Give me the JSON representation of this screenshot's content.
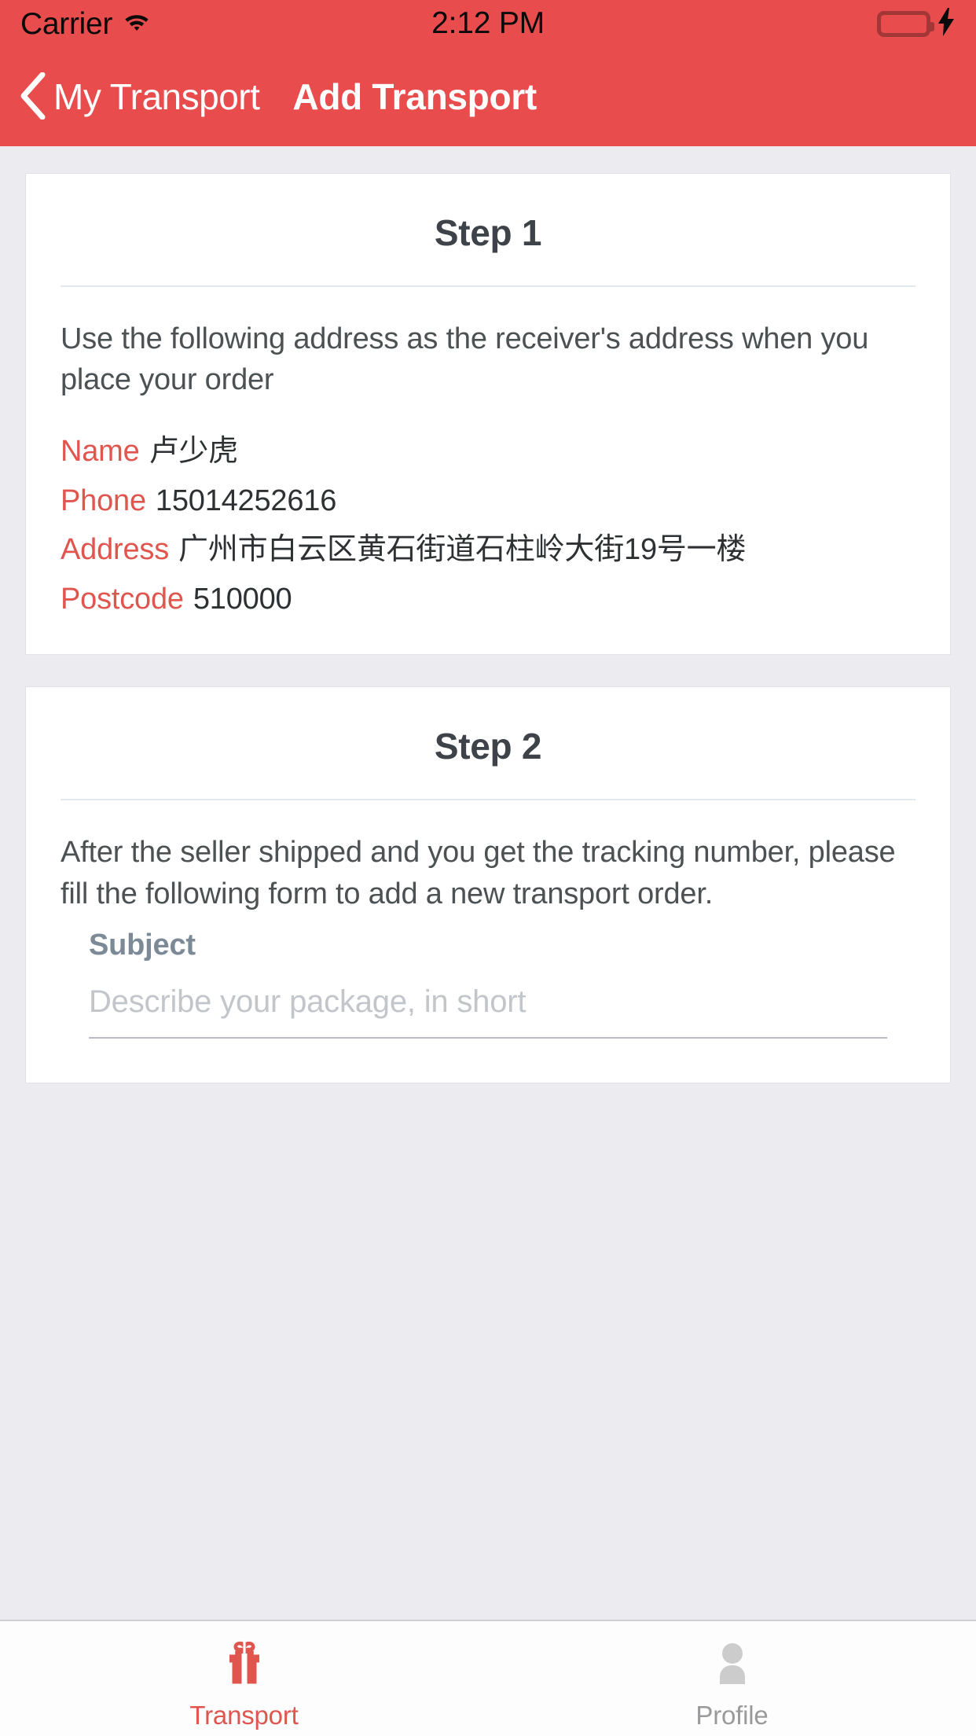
{
  "statusbar": {
    "carrier": "Carrier",
    "time": "2:12 PM",
    "wifi_icon": "wifi-icon",
    "battery_icon": "battery-full-icon",
    "charging_icon": "lightning-bolt-icon",
    "battery_color": "#56e05a"
  },
  "navbar": {
    "back_label": "My Transport",
    "back_icon": "chevron-left-icon",
    "title": "Add Transport",
    "background_color": "#e84c4c"
  },
  "step1": {
    "title": "Step 1",
    "intro": "Use the following address as the receiver's address when you place your order",
    "fields": [
      {
        "label": "Name",
        "value": "卢少虎"
      },
      {
        "label": "Phone",
        "value": "15014252616"
      },
      {
        "label": "Address",
        "value": "广州市白云区黄石街道石柱岭大街19号一楼"
      },
      {
        "label": "Postcode",
        "value": "510000"
      }
    ],
    "label_color": "#e0564f"
  },
  "step2": {
    "title": "Step 2",
    "intro": "After the seller shipped and you get the tracking number, please fill the following form to add a new transport order.",
    "form": {
      "subject_label": "Subject",
      "subject_value": "",
      "subject_placeholder": "Describe your package, in short"
    }
  },
  "tabbar": {
    "tabs": [
      {
        "label": "Transport",
        "icon": "gift-icon",
        "active": true,
        "color": "#e0564f"
      },
      {
        "label": "Profile",
        "icon": "person-icon",
        "active": false,
        "color": "#9a9a9d"
      }
    ]
  }
}
